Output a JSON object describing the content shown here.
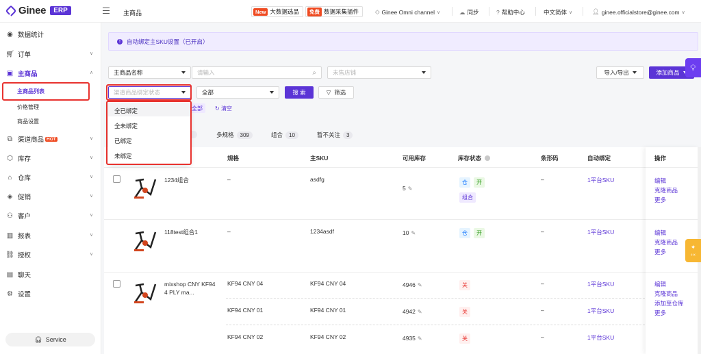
{
  "brand": {
    "logo_text": "Ginee",
    "badge": "ERP",
    "accent": "#5b34d6"
  },
  "topbar": {
    "title": "主商品",
    "promo1": {
      "tag": "New",
      "label": "大数据选品"
    },
    "promo2": {
      "tag": "免费",
      "label": "数据采集插件"
    },
    "omni": "Ginee Omni channel",
    "sync": "同步",
    "help": "帮助中心",
    "language": "中文简体",
    "account": "ginee.officialstore@ginee.com"
  },
  "sidebar": {
    "items": [
      {
        "label": "数据统计",
        "icon": "dashboard-icon"
      },
      {
        "label": "订单",
        "icon": "cart-icon"
      },
      {
        "label": "主商品",
        "icon": "bag-icon"
      },
      {
        "label": "渠道商品",
        "icon": "channel-icon",
        "hot": "HOT"
      },
      {
        "label": "库存",
        "icon": "box-icon"
      },
      {
        "label": "仓库",
        "icon": "warehouse-icon"
      },
      {
        "label": "促销",
        "icon": "tag-icon"
      },
      {
        "label": "客户",
        "icon": "users-icon"
      },
      {
        "label": "报表",
        "icon": "chart-icon"
      },
      {
        "label": "授权",
        "icon": "link-icon"
      },
      {
        "label": "聊天",
        "icon": "chat-icon"
      },
      {
        "label": "设置",
        "icon": "gear-icon"
      }
    ],
    "sub_items": [
      "主商品列表",
      "价格管理",
      "商品设置"
    ],
    "service": "Service"
  },
  "notice": "自动绑定主SKU设置（已开启）",
  "filters": {
    "field_select": "主商品名称",
    "search_placeholder": "请输入",
    "store_placeholder": "未售店铺",
    "bind_status_placeholder": "渠道商品绑定状态",
    "all_select": "全部",
    "search_button": "搜 索",
    "filter_button": "筛选",
    "selected_chip": "全部",
    "clear": "清空",
    "import_export": "导入/导出",
    "add_product": "添加商品"
  },
  "dropdown": {
    "options": [
      "全已绑定",
      "全未绑定",
      "已绑定",
      "未绑定"
    ]
  },
  "tabs": [
    {
      "label": "多规格",
      "count": "309"
    },
    {
      "label": "组合",
      "count": "10"
    },
    {
      "label": "暂不关注",
      "count": "3"
    }
  ],
  "table": {
    "headers": [
      "规格",
      "主SKU",
      "可用库存",
      "库存状态",
      "条形码",
      "自动绑定",
      "操作"
    ],
    "rows": [
      {
        "name": "1234组合",
        "variant": "–",
        "sku": "asdfg",
        "stock": "5",
        "badges": [
          "仓",
          "开",
          "组合"
        ],
        "barcode": "–",
        "bind": "1平台SKU",
        "ops": [
          "编辑",
          "克隆商品",
          "更多"
        ]
      },
      {
        "name": "118test组合1",
        "variant": "–",
        "sku": "1234asdf",
        "stock": "10",
        "badges": [
          "仓",
          "开"
        ],
        "barcode": "–",
        "bind": "1平台SKU",
        "ops": [
          "编辑",
          "克隆商品",
          "更多"
        ]
      },
      {
        "name": "mixshop CNY KF94 4 PLY ma...",
        "ops": [
          "编辑",
          "克隆商品",
          "添加至仓库",
          "更多"
        ],
        "variants": [
          {
            "variant": "KF94 CNY 04",
            "sku": "KF94 CNY 04",
            "stock": "4946",
            "badge": "关",
            "barcode": "–",
            "bind": "1平台SKU"
          },
          {
            "variant": "KF94 CNY 01",
            "sku": "KF94 CNY 01",
            "stock": "4942",
            "badge": "关",
            "barcode": "–",
            "bind": "1平台SKU"
          },
          {
            "variant": "KF94 CNY 02",
            "sku": "KF94 CNY 02",
            "stock": "4935",
            "badge": "关",
            "barcode": "–",
            "bind": "1平台SKU"
          }
        ]
      }
    ]
  }
}
